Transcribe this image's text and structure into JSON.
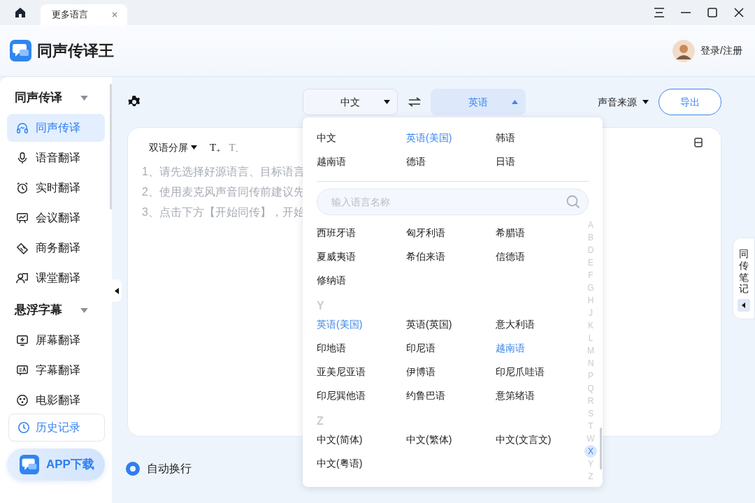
{
  "tabs": [
    {
      "label": "更多语言",
      "selected": true
    }
  ],
  "app": {
    "name": "同声传译王",
    "login": "登录/注册"
  },
  "sidebar": {
    "groups": [
      {
        "title": "同声传译",
        "expanded": true,
        "items": [
          {
            "label": "同声传译",
            "selected": true
          },
          {
            "label": "语音翻译",
            "selected": false
          },
          {
            "label": "实时翻译",
            "selected": false
          },
          {
            "label": "会议翻译",
            "selected": false
          },
          {
            "label": "商务翻译",
            "selected": false
          },
          {
            "label": "课堂翻译",
            "selected": false
          }
        ]
      },
      {
        "title": "悬浮字幕",
        "expanded": true,
        "items": [
          {
            "label": "屏幕翻译",
            "selected": false
          },
          {
            "label": "字幕翻译",
            "selected": false
          },
          {
            "label": "电影翻译",
            "selected": false
          }
        ]
      }
    ],
    "history": "历史记录",
    "app_download": "APP下载"
  },
  "toolbar": {
    "source": "中文",
    "target": "英语",
    "target_expanded": true,
    "sound_source": "声音来源",
    "export": "导出"
  },
  "editor": {
    "view_mode": "双语分屏",
    "font_larger": "T$_{+}$",
    "font_smaller": "T$_{-}$",
    "hints": [
      "1、请先选择好源语言、目标语言",
      "2、使用麦克风声音同传前建议先",
      "3、点击下方【开始同传】，开始"
    ]
  },
  "auto_wrap": {
    "label": "自动换行",
    "checked": true
  },
  "notes_tab": {
    "label": "同传笔记"
  },
  "dropdown": {
    "frequent": [
      {
        "label": "中文",
        "selected": false
      },
      {
        "label": "英语(美国)",
        "selected": true
      },
      {
        "label": "韩语",
        "selected": false
      },
      {
        "label": "越南语",
        "selected": false
      },
      {
        "label": "德语",
        "selected": false
      },
      {
        "label": "日语",
        "selected": false
      }
    ],
    "search": {
      "placeholder": "输入语言名称"
    },
    "sections": [
      {
        "items": [
          {
            "label": "西班牙语",
            "selected": false
          },
          {
            "label": "匈牙利语",
            "selected": false
          },
          {
            "label": "希腊语",
            "selected": false
          },
          {
            "label": "夏威夷语",
            "selected": false
          },
          {
            "label": "希伯来语",
            "selected": false
          },
          {
            "label": "信德语",
            "selected": false
          },
          {
            "label": "修纳语",
            "selected": false
          }
        ]
      },
      {
        "letter": "Y",
        "items": [
          {
            "label": "英语(美国)",
            "selected": true
          },
          {
            "label": "英语(英国)",
            "selected": false
          },
          {
            "label": "意大利语",
            "selected": false
          },
          {
            "label": "印地语",
            "selected": false
          },
          {
            "label": "印尼语",
            "selected": false
          },
          {
            "label": "越南语",
            "selected": true
          },
          {
            "label": "亚美尼亚语",
            "selected": false
          },
          {
            "label": "伊博语",
            "selected": false
          },
          {
            "label": "印尼爪哇语",
            "selected": false
          },
          {
            "label": "印尼巽他语",
            "selected": false
          },
          {
            "label": "约鲁巴语",
            "selected": false
          },
          {
            "label": "意第绪语",
            "selected": false
          }
        ]
      },
      {
        "letter": "Z",
        "items": [
          {
            "label": "中文(简体)",
            "selected": false
          },
          {
            "label": "中文(繁体)",
            "selected": false
          },
          {
            "label": "中文(文言文)",
            "selected": false
          },
          {
            "label": "中文(粤语)",
            "selected": false
          }
        ]
      }
    ],
    "index": [
      {
        "letter": "A",
        "selected": false
      },
      {
        "letter": "B",
        "selected": false
      },
      {
        "letter": "D",
        "selected": false
      },
      {
        "letter": "E",
        "selected": false
      },
      {
        "letter": "F",
        "selected": false
      },
      {
        "letter": "G",
        "selected": false
      },
      {
        "letter": "H",
        "selected": false
      },
      {
        "letter": "J",
        "selected": false
      },
      {
        "letter": "K",
        "selected": false
      },
      {
        "letter": "L",
        "selected": false
      },
      {
        "letter": "M",
        "selected": false
      },
      {
        "letter": "N",
        "selected": false
      },
      {
        "letter": "P",
        "selected": false
      },
      {
        "letter": "Q",
        "selected": false
      },
      {
        "letter": "R",
        "selected": false
      },
      {
        "letter": "S",
        "selected": false
      },
      {
        "letter": "T",
        "selected": false
      },
      {
        "letter": "W",
        "selected": false
      },
      {
        "letter": "X",
        "selected": true
      },
      {
        "letter": "Y",
        "selected": false
      },
      {
        "letter": "Z",
        "selected": false
      }
    ]
  }
}
